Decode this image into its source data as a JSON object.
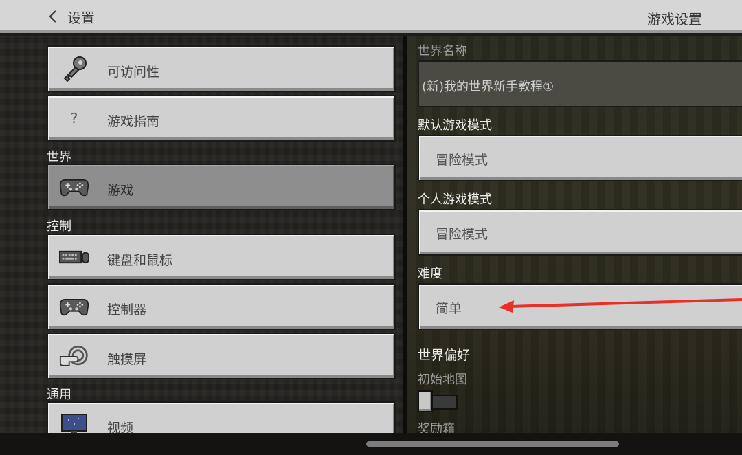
{
  "header": {
    "back_label": "设置",
    "title": "游戏设置"
  },
  "sidebar": {
    "items_top": [
      {
        "label": "可访问性",
        "icon": "key-icon"
      },
      {
        "label": "游戏指南",
        "icon": "question-icon",
        "glyph": "?"
      }
    ],
    "sections": {
      "world": "世界",
      "controls": "控制",
      "general": "通用"
    },
    "world_items": [
      {
        "label": "游戏",
        "icon": "controller-icon",
        "active": true
      }
    ],
    "control_items": [
      {
        "label": "键盘和鼠标",
        "icon": "keyboard-mouse-icon"
      },
      {
        "label": "控制器",
        "icon": "controller-icon"
      },
      {
        "label": "触摸屏",
        "icon": "touch-icon"
      }
    ],
    "general_items": [
      {
        "label": "视频",
        "icon": "monitor-icon"
      }
    ]
  },
  "settings": {
    "world_name_label": "世界名称",
    "world_name_value": "(新)我的世界新手教程①",
    "default_mode_label": "默认游戏模式",
    "default_mode_value": "冒险模式",
    "personal_mode_label": "个人游戏模式",
    "personal_mode_value": "冒险模式",
    "difficulty_label": "难度",
    "difficulty_value": "简单",
    "world_prefs_label": "世界偏好",
    "starting_map_label": "初始地图",
    "starting_map_on": false,
    "bonus_chest_label": "奖励箱"
  },
  "colors": {
    "annotation_arrow": "#e8302a"
  }
}
